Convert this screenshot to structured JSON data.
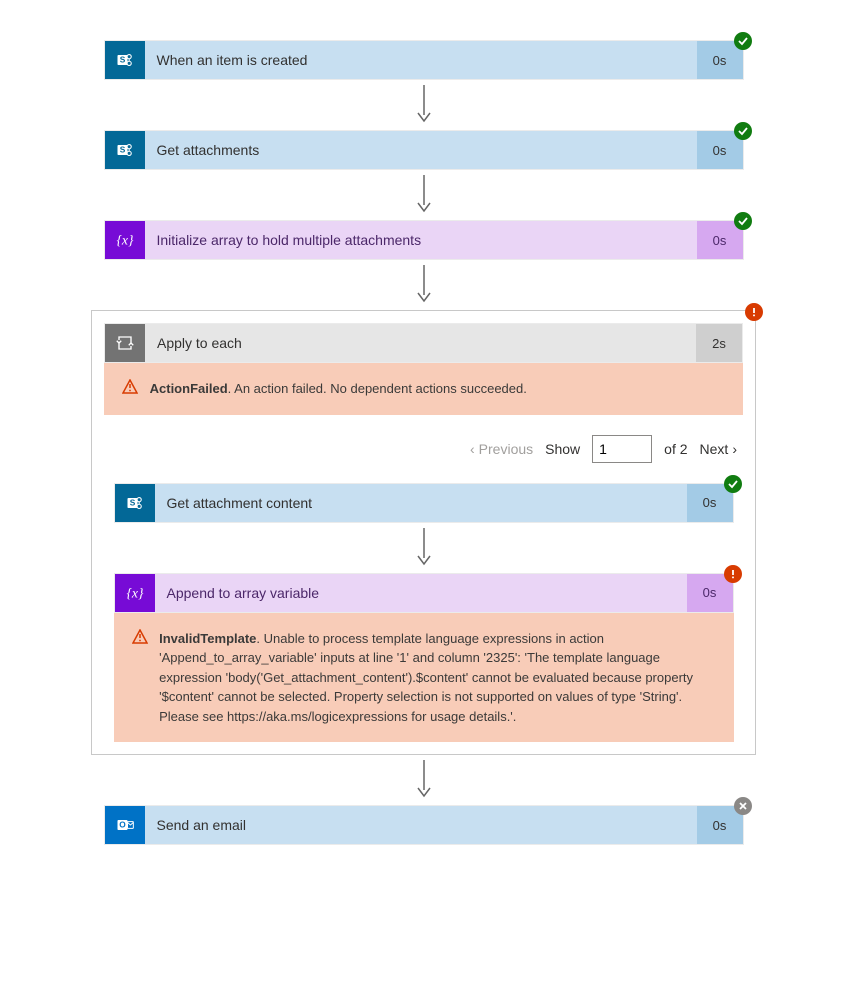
{
  "steps": {
    "s1": {
      "title": "When an item is created",
      "time": "0s"
    },
    "s2": {
      "title": "Get attachments",
      "time": "0s"
    },
    "s3": {
      "title": "Initialize array to hold multiple attachments",
      "time": "0s"
    },
    "loop": {
      "title": "Apply to each",
      "time": "2s"
    },
    "s4": {
      "title": "Get attachment content",
      "time": "0s"
    },
    "s5": {
      "title": "Append to array variable",
      "time": "0s"
    },
    "s6": {
      "title": "Send an email",
      "time": "0s"
    }
  },
  "errors": {
    "loop": {
      "code": "ActionFailed",
      "msg": ". An action failed. No dependent actions succeeded."
    },
    "append": {
      "code": "InvalidTemplate",
      "msg": ". Unable to process template language expressions in action 'Append_to_array_variable' inputs at line '1' and column '2325': 'The template language expression 'body('Get_attachment_content').$content' cannot be evaluated because property '$content' cannot be selected. Property selection is not supported on values of type 'String'. Please see https://aka.ms/logicexpressions for usage details.'."
    }
  },
  "pager": {
    "prev": "Previous",
    "show": "Show",
    "value": "1",
    "of": "of 2",
    "next": "Next"
  }
}
